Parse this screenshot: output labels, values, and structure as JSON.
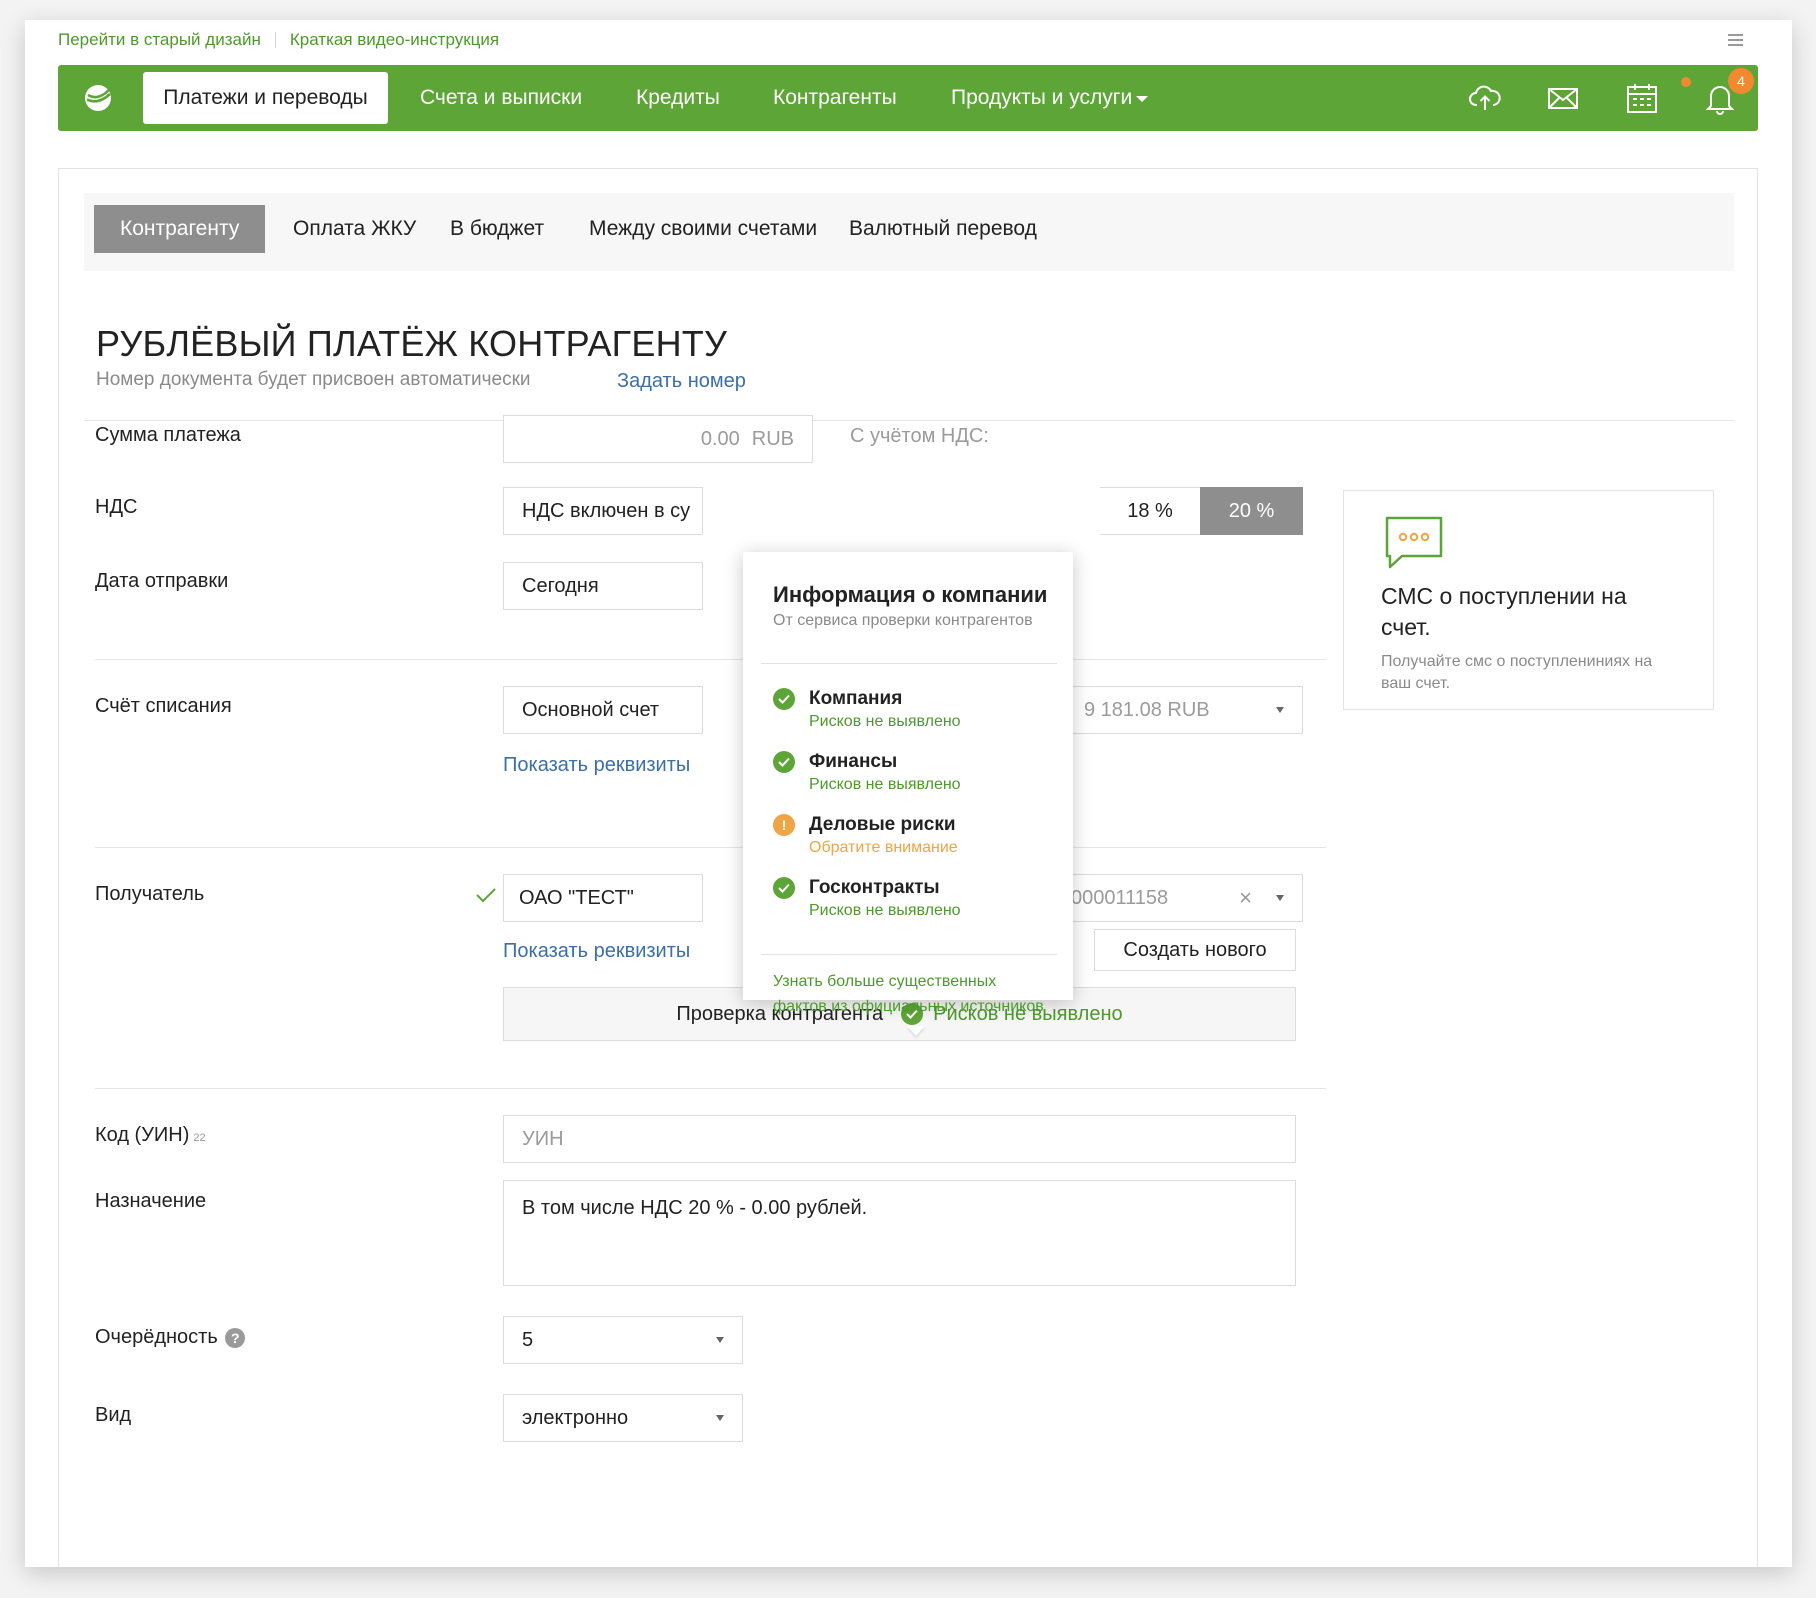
{
  "top_links": [
    "Перейти в старый дизайн",
    "Краткая видео-инструкция"
  ],
  "nav": {
    "items": [
      "Платежи и переводы",
      "Счета и выписки",
      "Кредиты",
      "Контрагенты",
      "Продукты и услуги"
    ],
    "active_index": 0,
    "notification_count": "4",
    "icons": [
      "cloud-upload-icon",
      "mail-icon",
      "calendar-icon",
      "bell-icon"
    ]
  },
  "tabs": [
    "Контрагенту",
    "Оплата ЖКУ",
    "В бюджет",
    "Между своими счетами",
    "Валютный перевод"
  ],
  "page": {
    "title": "РУБЛЁВЫЙ ПЛАТЁЖ КОНТРАГЕНТУ",
    "subtitle": "Номер документа будет присвоен автоматически",
    "set_number_link": "Задать номер"
  },
  "form": {
    "amount": {
      "label": "Сумма платежа",
      "value": "0.00",
      "currency": "RUB",
      "vat_note": "С учётом НДС:"
    },
    "vat": {
      "label": "НДС",
      "value": "НДС включен в су",
      "options": [
        "18 %",
        "20 %"
      ],
      "selected": "20 %"
    },
    "date": {
      "label": "Дата отправки",
      "value": "Сегодня"
    },
    "account": {
      "label": "Счёт списания",
      "value": "Основной счет",
      "balance": "9 181.08 RUB",
      "details_link": "Показать реквизиты"
    },
    "recipient": {
      "label": "Получатель",
      "value": "ОАО \"ТЕСТ\"",
      "account_tail": "000011158",
      "details_link": "Показать реквизиты",
      "create_button": "Создать нового"
    },
    "verify": {
      "label": "Проверка контрагента",
      "result": "Рисков не выявлено"
    },
    "uin": {
      "label": "Код (УИН)",
      "sup": "22",
      "placeholder": "УИН"
    },
    "purpose": {
      "label": "Назначение",
      "value": "В том числе НДС 20 % - 0.00 рублей."
    },
    "priority": {
      "label": "Очерёдность",
      "value": "5"
    },
    "kind": {
      "label": "Вид",
      "value": "электронно"
    }
  },
  "sms_card": {
    "title": "СМС о поступлении на счет.",
    "text": "Получайте смс о поступлениниях на ваш счет."
  },
  "popup": {
    "title": "Информация о компании",
    "subtitle": "От сервиса проверки контрагентов",
    "items": [
      {
        "name": "Компания",
        "status": "Рисков не выявлено",
        "level": "ok"
      },
      {
        "name": "Финансы",
        "status": "Рисков не выявлено",
        "level": "ok"
      },
      {
        "name": "Деловые риски",
        "status": "Обратите внимание",
        "level": "warn"
      },
      {
        "name": "Госконтракты",
        "status": "Рисков не выявлено",
        "level": "ok"
      }
    ],
    "more_line1": "Узнать больше существенных",
    "more_line2": "фактов из официальных источников"
  },
  "colors": {
    "brand_green": "#5ea538",
    "link_green": "#4c9a2a",
    "link_blue": "#3b6fa8",
    "warning_orange": "#f0a443",
    "badge_orange": "#f0892f"
  }
}
